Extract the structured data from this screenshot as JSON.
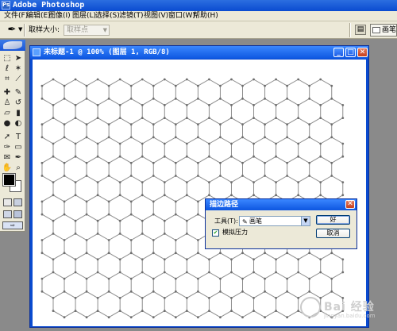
{
  "app": {
    "title": "Adobe Photoshop",
    "icon": "ps-app-icon"
  },
  "menu": [
    "文件(F)",
    "编辑(E)",
    "图像(I)",
    "图层(L)",
    "选择(S)",
    "滤镜(T)",
    "视图(V)",
    "窗口(W)",
    "帮助(H)"
  ],
  "options_bar": {
    "tool_icon": "eyedropper-icon",
    "sample_size_label": "取样大小:",
    "sample_size_value": "取样点",
    "brushes_tab": "画笔"
  },
  "toolbox": {
    "tools": [
      "marquee-icon",
      "move-icon",
      "lasso-icon",
      "magic-wand-icon",
      "crop-icon",
      "slice-icon",
      "healing-brush-icon",
      "brush-icon",
      "clone-stamp-icon",
      "history-brush-icon",
      "eraser-icon",
      "gradient-icon",
      "blur-icon",
      "dodge-icon",
      "path-selection-icon",
      "type-icon",
      "pen-icon",
      "shape-icon",
      "notes-icon",
      "eyedropper-icon",
      "hand-icon",
      "zoom-icon"
    ],
    "foreground_color": "#000000",
    "background_color": "#ffffff"
  },
  "document": {
    "title": "未标题-1 @ 100% (图层 1, RGB/8)",
    "canvas_background": "#ffffff",
    "pattern": "hexagon-grid",
    "line_color": "#8c8c8c"
  },
  "dialog": {
    "title": "描边路径",
    "tool_label": "工具(T):",
    "tool_value": "画笔",
    "simulate_pressure_label": "模拟压力",
    "simulate_pressure_checked": true,
    "ok_label": "好",
    "cancel_label": "取消"
  },
  "watermark": {
    "text": "Bai 经验",
    "url": "jingyan.baidu.com"
  },
  "colors": {
    "titlebar": "#0a4bd0",
    "chrome": "#ece9d8",
    "workspace": "#8a8a8a"
  }
}
